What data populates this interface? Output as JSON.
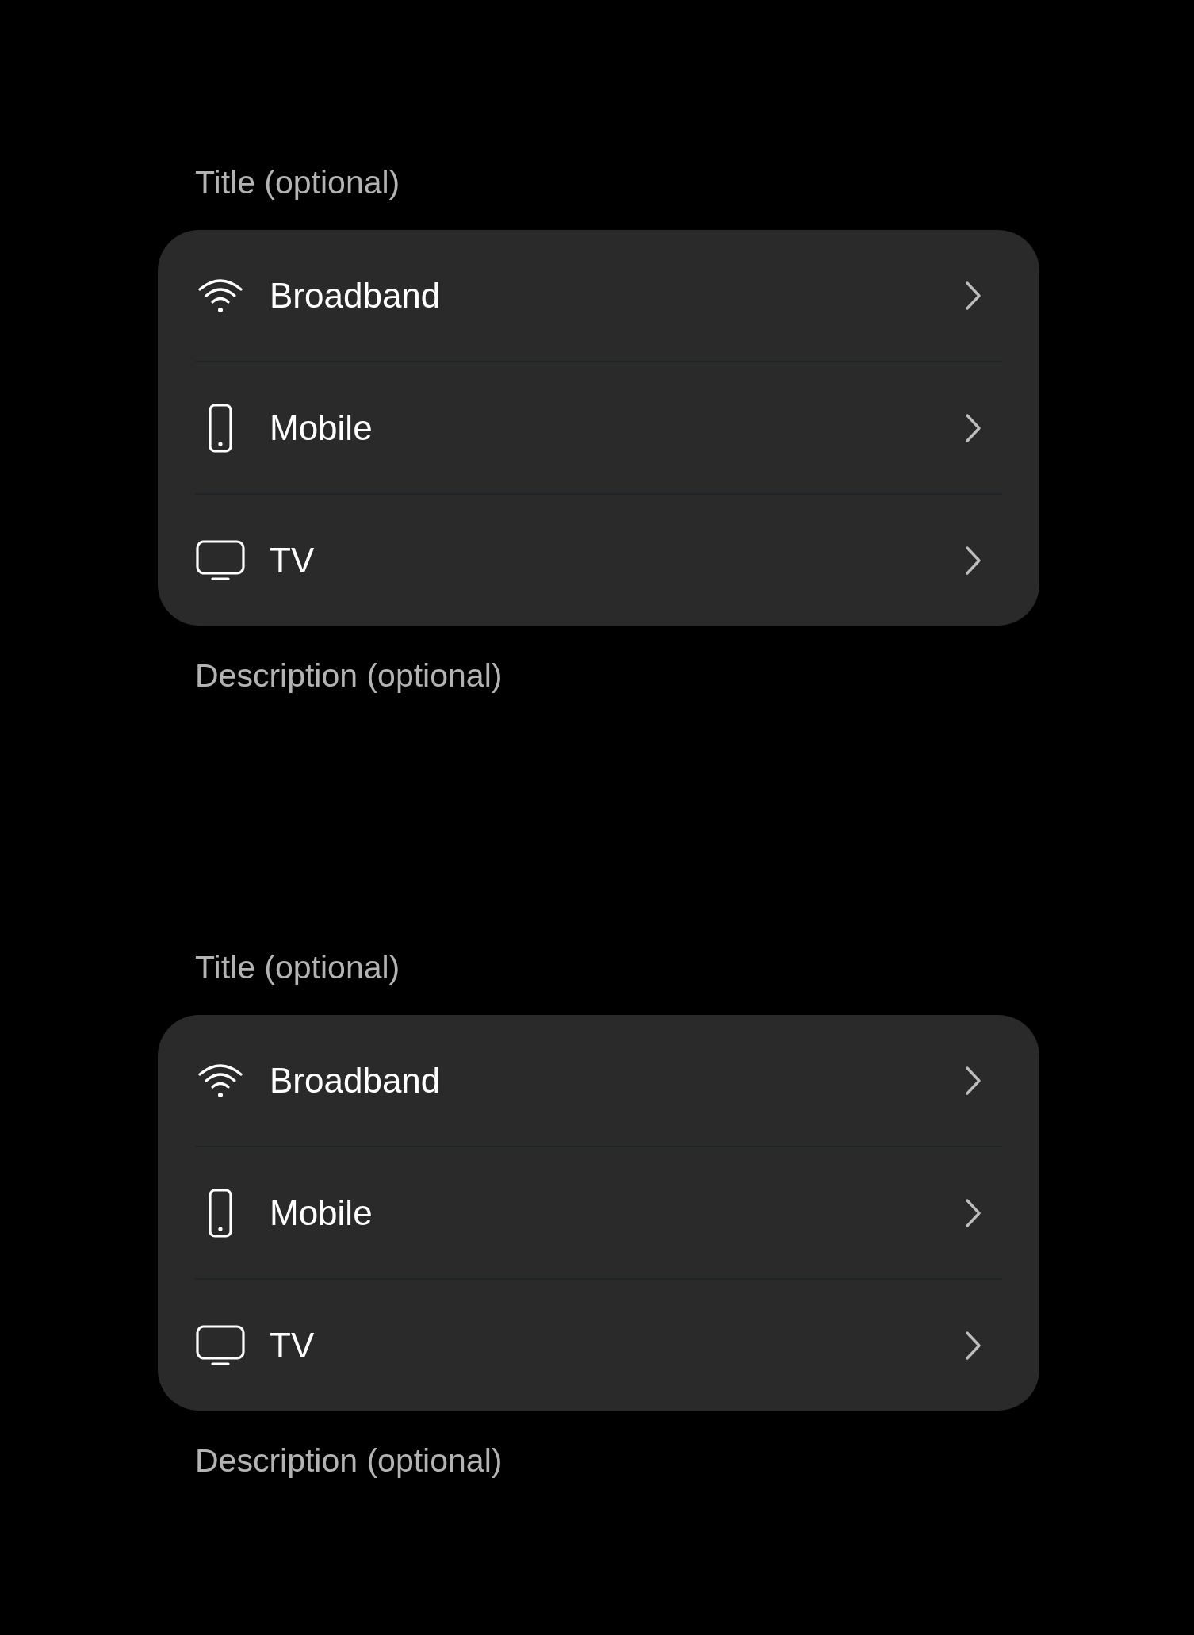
{
  "groups": [
    {
      "title": "Title (optional)",
      "items": [
        {
          "label": "Broadband"
        },
        {
          "label": "Mobile"
        },
        {
          "label": "TV"
        }
      ],
      "description": "Description (optional)"
    },
    {
      "title": "Title (optional)",
      "items": [
        {
          "label": "Broadband"
        },
        {
          "label": "Mobile"
        },
        {
          "label": "TV"
        }
      ],
      "description": "Description (optional)"
    }
  ]
}
